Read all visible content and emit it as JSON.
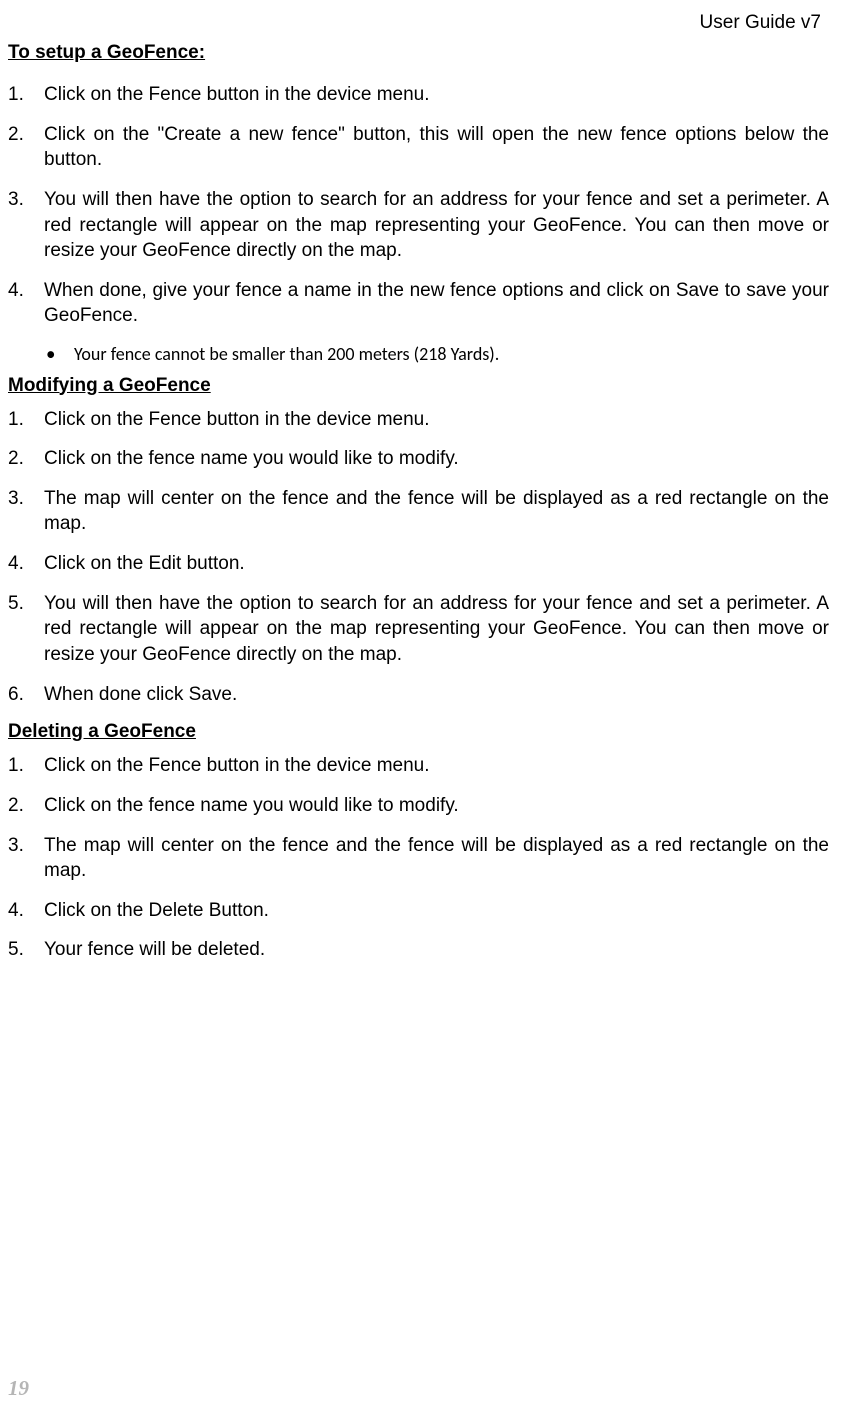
{
  "header": {
    "title": "User Guide v7"
  },
  "sections": [
    {
      "heading": "To setup a GeoFence:",
      "items": [
        "Click on the Fence button in the device menu.",
        "Click on the \"Create a new fence\" button, this will open the new fence options below the button.",
        "You will then have the option to search for an address for your fence and set a perimeter.  A red rectangle will appear on the map representing your GeoFence.  You can then move or resize your GeoFence directly on the map.",
        "When done, give your fence a name in the new fence options and click on Save to save your GeoFence."
      ],
      "bullet": "Your fence cannot be smaller than 200 meters (218 Yards)."
    },
    {
      "heading": "Modifying a GeoFence",
      "items": [
        "Click on the Fence button in the device menu.",
        "Click on the fence name you would like to modify.",
        "The map will center on the fence and the fence will be displayed as a red rectangle on the map.",
        "Click on the Edit button.",
        "You will then have the option to search for an address for your fence and set a perimeter.  A red rectangle will appear on the map representing your GeoFence.  You can then move or resize your GeoFence directly on the map.",
        "When done click Save."
      ]
    },
    {
      "heading": "Deleting a GeoFence",
      "items": [
        "Click on the Fence button in the device menu.",
        "Click on the fence name you would like to modify.",
        "The map will center on the fence and the fence will be displayed as a red rectangle on the map.",
        "Click on the Delete Button.",
        "Your fence will be deleted."
      ]
    }
  ],
  "page_number": "19"
}
